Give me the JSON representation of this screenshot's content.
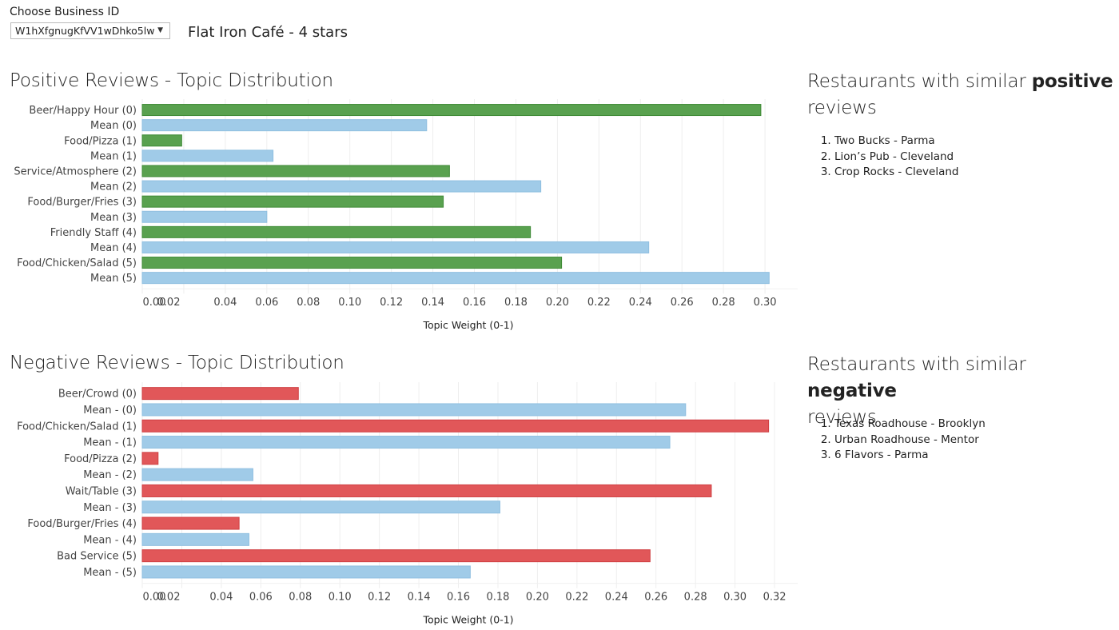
{
  "header": {
    "choose_label": "Choose Business ID",
    "business_id_selected": "W1hXfgnugKfVV1wDhko5lw",
    "dropdown_caret_icon": "triangle-down",
    "business_title": "Flat Iron Café - 4 stars"
  },
  "colors": {
    "positive": "#59a14f",
    "negative": "#e15759",
    "mean": "#a0cbe8",
    "gridline": "#eeeeee"
  },
  "chart_data": [
    {
      "type": "bar",
      "orientation": "horizontal",
      "title": "Positive Reviews - Topic Distribution",
      "xlabel": "Topic Weight (0-1)",
      "ylabel": "",
      "xlim": [
        0,
        0.31
      ],
      "xticks": [
        "0.00",
        "0.02",
        "0.04",
        "0.06",
        "0.08",
        "0.10",
        "0.12",
        "0.14",
        "0.16",
        "0.18",
        "0.20",
        "0.22",
        "0.24",
        "0.26",
        "0.28",
        "0.30"
      ],
      "grid": true,
      "categories": [
        "Beer/Happy Hour (0)",
        "Mean (0)",
        "Food/Pizza (1)",
        "Mean (1)",
        "Service/Atmosphere (2)",
        "Mean (2)",
        "Food/Burger/Fries (3)",
        "Mean (3)",
        "Friendly Staff (4)",
        "Mean (4)",
        "Food/Chicken/Salad (5)",
        "Mean (5)"
      ],
      "values": [
        0.298,
        0.137,
        0.019,
        0.063,
        0.148,
        0.192,
        0.145,
        0.06,
        0.187,
        0.244,
        0.202,
        0.302
      ],
      "series_kind": [
        "topic",
        "mean",
        "topic",
        "mean",
        "topic",
        "mean",
        "topic",
        "mean",
        "topic",
        "mean",
        "topic",
        "mean"
      ]
    },
    {
      "type": "bar",
      "orientation": "horizontal",
      "title": "Negative Reviews - Topic Distribution",
      "xlabel": "Topic Weight (0-1)",
      "ylabel": "",
      "xlim": [
        0,
        0.33
      ],
      "xticks": [
        "0.00",
        "0.02",
        "0.04",
        "0.06",
        "0.08",
        "0.10",
        "0.12",
        "0.14",
        "0.16",
        "0.18",
        "0.20",
        "0.22",
        "0.24",
        "0.26",
        "0.28",
        "0.30",
        "0.32"
      ],
      "grid": true,
      "categories": [
        "Beer/Crowd (0)",
        "Mean - (0)",
        "Food/Chicken/Salad (1)",
        "Mean - (1)",
        "Food/Pizza (2)",
        "Mean - (2)",
        "Wait/Table (3)",
        "Mean - (3)",
        "Food/Burger/Fries (4)",
        "Mean - (4)",
        "Bad Service (5)",
        "Mean - (5)"
      ],
      "values": [
        0.079,
        0.275,
        0.317,
        0.267,
        0.008,
        0.056,
        0.288,
        0.181,
        0.049,
        0.054,
        0.257,
        0.166
      ],
      "series_kind": [
        "topic",
        "mean",
        "topic",
        "mean",
        "topic",
        "mean",
        "topic",
        "mean",
        "topic",
        "mean",
        "topic",
        "mean"
      ]
    }
  ],
  "similar_positive": {
    "title_prefix": "Restaurants with similar ",
    "title_bold": "positive",
    "title_suffix": "reviews",
    "items": [
      "Two Bucks - Parma",
      "Lion’s Pub - Cleveland",
      "Crop Rocks - Cleveland"
    ]
  },
  "similar_negative": {
    "title_prefix": "Restaurants with similar ",
    "title_bold": "negative",
    "title_suffix": "reviews",
    "items": [
      "Texas Roadhouse - Brooklyn",
      "Urban Roadhouse - Mentor",
      "6 Flavors - Parma"
    ]
  }
}
